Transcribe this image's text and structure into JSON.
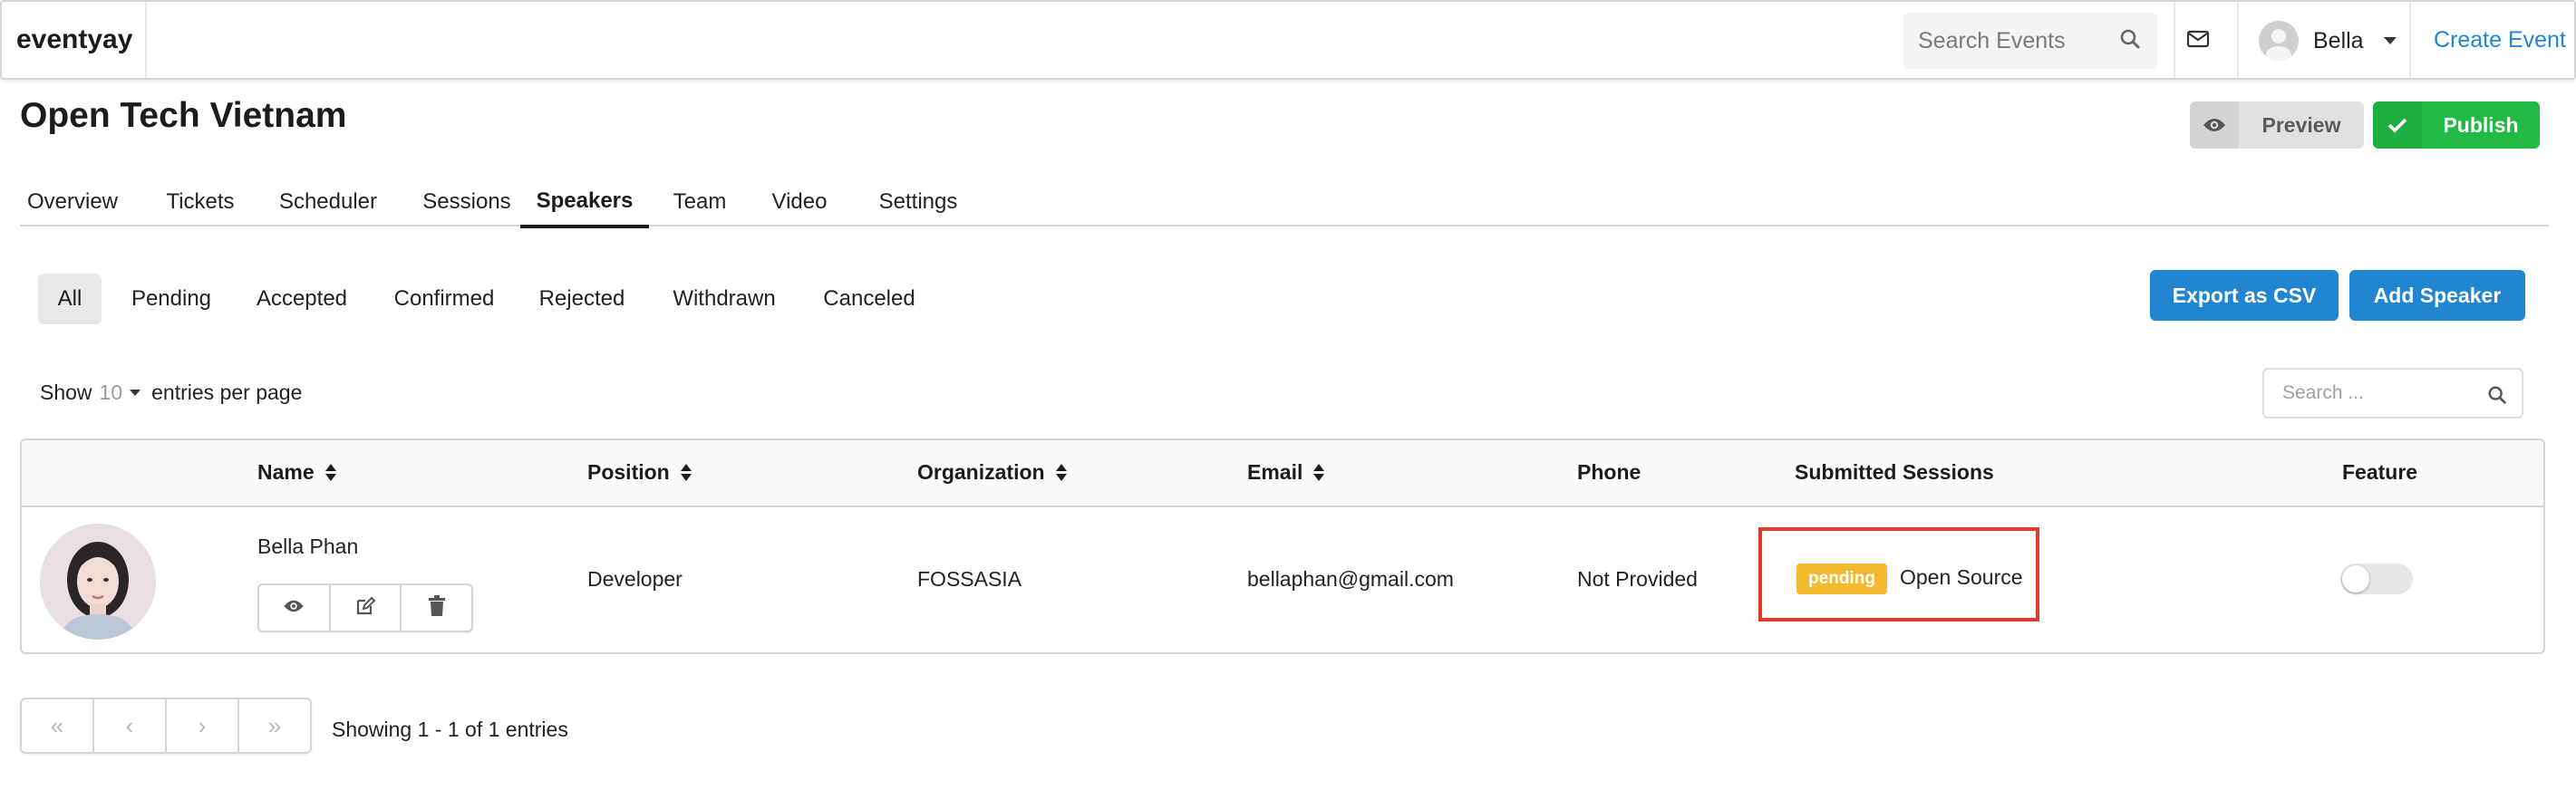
{
  "navbar": {
    "brand": "eventyay",
    "search_placeholder": "Search Events",
    "user_name": "Bella",
    "create_event": "Create Event"
  },
  "header": {
    "title": "Open Tech Vietnam",
    "preview_label": "Preview",
    "publish_label": "Publish"
  },
  "tabs": [
    "Overview",
    "Tickets",
    "Scheduler",
    "Sessions",
    "Speakers",
    "Team",
    "Video",
    "Settings"
  ],
  "active_tab": "Speakers",
  "filters": [
    "All",
    "Pending",
    "Accepted",
    "Confirmed",
    "Rejected",
    "Withdrawn",
    "Canceled"
  ],
  "active_filter": "All",
  "actions": {
    "export_label": "Export as CSV",
    "add_label": "Add Speaker"
  },
  "entries": {
    "show": "Show",
    "per_page_value": "10",
    "suffix": "entries per page",
    "search_placeholder": "Search ..."
  },
  "table": {
    "columns": [
      "Name",
      "Position",
      "Organization",
      "Email",
      "Phone",
      "Submitted Sessions",
      "Feature"
    ],
    "rows": [
      {
        "name": "Bella Phan",
        "position": "Developer",
        "organization": "FOSSASIA",
        "email": "bellaphan@gmail.com",
        "phone": "Not Provided",
        "session_status": "pending",
        "session_title": "Open Source",
        "featured": false
      }
    ]
  },
  "pagination": {
    "first": "«",
    "prev": "‹",
    "next": "›",
    "last": "»",
    "summary": "Showing 1 - 1 of 1 entries"
  },
  "colors": {
    "primary": "#2185d0",
    "success": "#21ba45",
    "pending_badge": "#f3ba2f",
    "highlight": "#e03a2b"
  }
}
